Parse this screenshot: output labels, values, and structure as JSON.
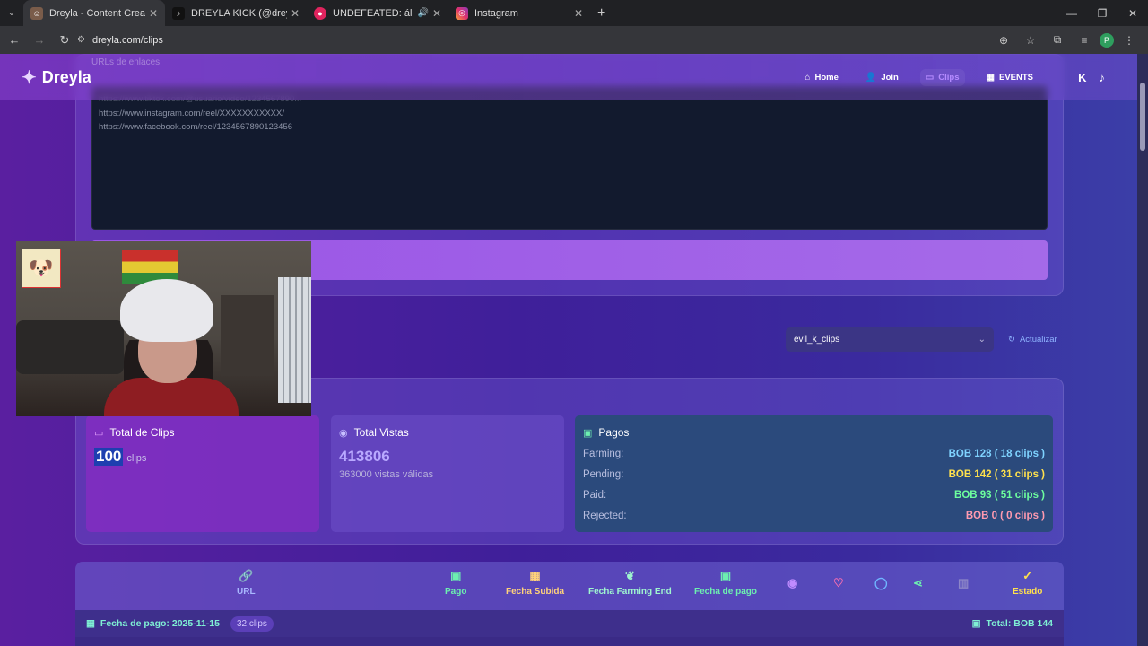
{
  "browser": {
    "tabs": [
      {
        "title": "Dreyla - Content Creator & Stre",
        "active": true
      },
      {
        "title": "DREYLA KICK (@dreyla.kick) | Ti",
        "active": false
      },
      {
        "title": "UNDEFEATED: álbum de XG",
        "active": false
      },
      {
        "title": "Instagram",
        "active": false
      }
    ],
    "url": "dreyla.com/clips",
    "profile_initial": "P"
  },
  "site": {
    "brand": "Dreyla",
    "faded_label": "URLs de enlaces",
    "nav": [
      {
        "label": "Home"
      },
      {
        "label": "Join"
      },
      {
        "label": "Clips"
      },
      {
        "label": "EVENTS"
      }
    ]
  },
  "url_input": {
    "lines": [
      "https://www.tiktok.com/@usuario/video/1234567890...",
      "https://www.instagram.com/reel/XXXXXXXXXXX/",
      "https://www.facebook.com/reel/1234567890123456"
    ]
  },
  "filter": {
    "selected_account": "evil_k_clips",
    "refresh_label": "Actualizar"
  },
  "stats": {
    "total_clips": {
      "title": "Total de Clips",
      "value": "100",
      "unit": "clips"
    },
    "total_views": {
      "title": "Total Vistas",
      "value": "413806",
      "sub": "363000 vistas válidas"
    },
    "payments": {
      "title": "Pagos",
      "rows": [
        {
          "label": "Farming:",
          "value": "BOB 128 ( 18 clips )",
          "color": "#7fd3ff"
        },
        {
          "label": "Pending:",
          "value": "BOB 142 ( 31 clips )",
          "color": "#ffe14d"
        },
        {
          "label": "Paid:",
          "value": "BOB 93 ( 51 clips )",
          "color": "#6dff9e"
        },
        {
          "label": "Rejected:",
          "value": "BOB 0 ( 0 clips )",
          "color": "#ff9ab0"
        }
      ]
    }
  },
  "table": {
    "headers": {
      "url": "URL",
      "pago": "Pago",
      "fecha_subida": "Fecha Subida",
      "fecha_farming_end": "Fecha Farming End",
      "fecha_de_pago": "Fecha de pago",
      "estado": "Estado"
    },
    "group": {
      "label": "Fecha de pago: 2025-11-15",
      "count_badge": "32 clips",
      "total": "Total: BOB 144"
    }
  }
}
